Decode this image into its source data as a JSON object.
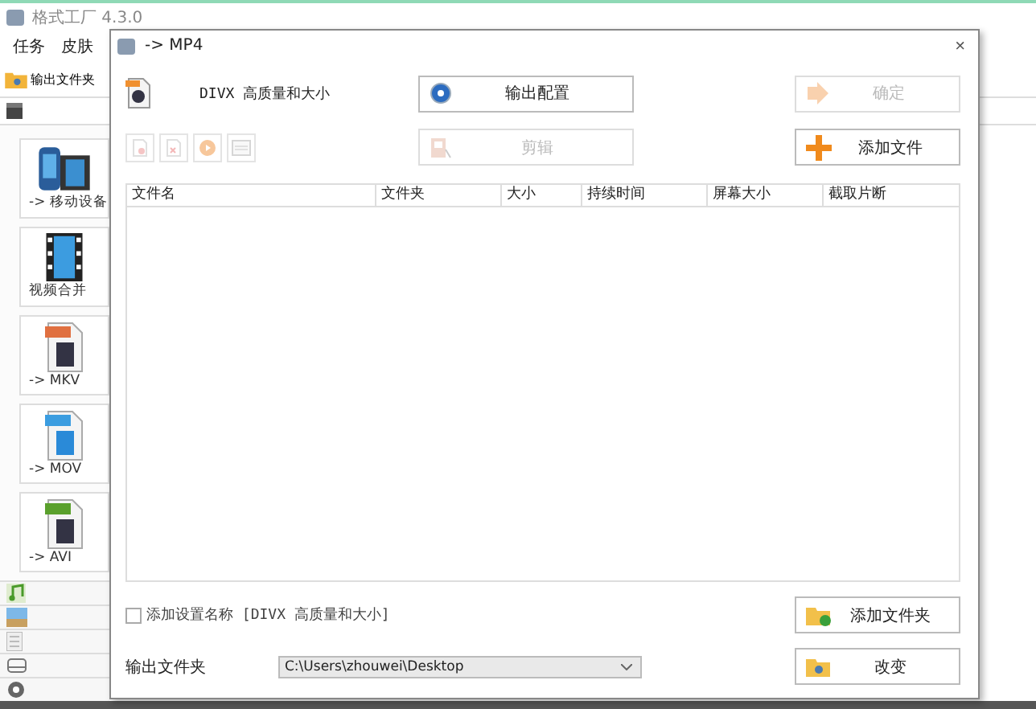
{
  "app": {
    "title": "格式工厂 4.3.0",
    "menu": [
      "任务",
      "皮肤"
    ],
    "toolbar_button": "输出文件夹",
    "categories": [
      {
        "label": "-> 移动设备",
        "kind": "mobile"
      },
      {
        "label": "视频合并",
        "kind": "film"
      },
      {
        "label": "-> MKV",
        "kind": "mkv"
      },
      {
        "label": "-> MOV",
        "kind": "mov"
      },
      {
        "label": "-> AVI",
        "kind": "avi"
      }
    ],
    "side_groups": [
      {
        "kind": "audio"
      },
      {
        "kind": "picture"
      },
      {
        "kind": "document"
      },
      {
        "kind": "disc"
      },
      {
        "kind": "tools"
      }
    ]
  },
  "dialog": {
    "title": "-> MP4",
    "close": "×",
    "profile": "DIVX 高质量和大小",
    "buttons": [
      {
        "label": "输出配置",
        "kind": "config",
        "disabled": false
      },
      {
        "label": "确定",
        "kind": "ok",
        "disabled": true
      },
      {
        "label": "剪辑",
        "kind": "clip",
        "disabled": true
      },
      {
        "label": "添加文件",
        "kind": "add",
        "disabled": false
      },
      {
        "label": "添加文件夹",
        "kind": "folder",
        "disabled": false
      },
      {
        "label": "改变",
        "kind": "change",
        "disabled": false
      }
    ],
    "tools": [
      {
        "kind": "remove",
        "disabled": true
      },
      {
        "kind": "clear",
        "disabled": true
      },
      {
        "kind": "play",
        "disabled": true
      },
      {
        "kind": "info",
        "disabled": true
      }
    ],
    "table": {
      "columns": [
        "文件名",
        "文件夹",
        "大小",
        "持续时间",
        "屏幕大小",
        "截取片断"
      ]
    },
    "add_name": {
      "label": "添加设置名称 [DIVX 高质量和大小]",
      "checked": false
    },
    "output_folder": {
      "label": "输出文件夹",
      "value": "C:\\Users\\zhouwei\\Desktop"
    }
  }
}
